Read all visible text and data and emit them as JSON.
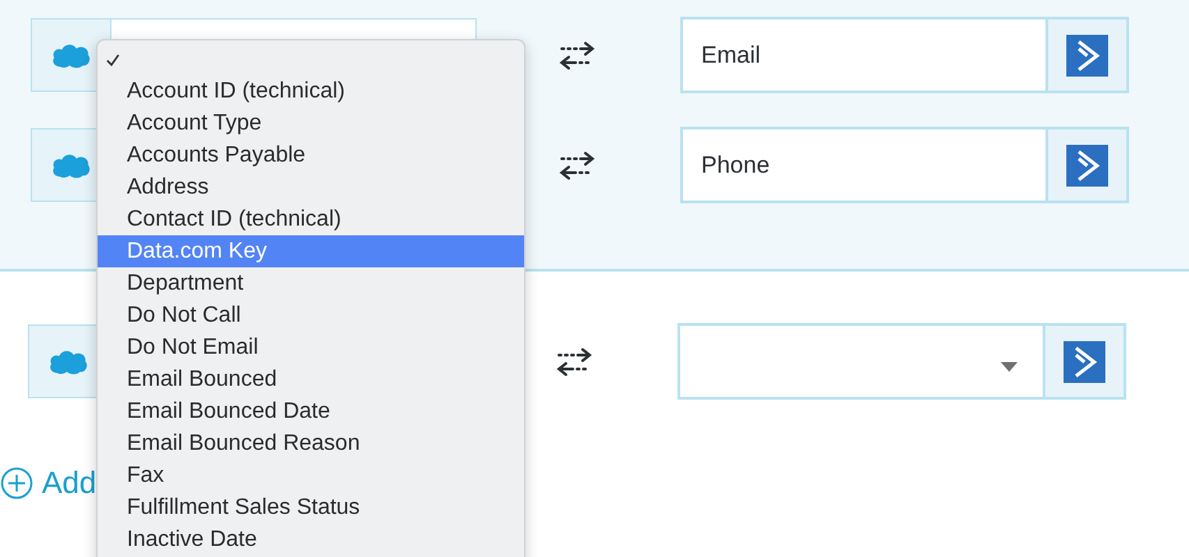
{
  "mapping_groups": [
    {
      "kind": "panel",
      "rows": [
        {
          "target": {
            "kind": "text",
            "value": "Email"
          }
        },
        {
          "target": {
            "kind": "text",
            "value": "Phone"
          }
        }
      ]
    },
    {
      "kind": "plain",
      "rows": [
        {
          "target": {
            "kind": "select"
          }
        }
      ]
    }
  ],
  "add_button": {
    "label": "Add"
  },
  "dropdown": {
    "items": [
      {
        "checked": true,
        "selected": false
      },
      {
        "label": "Account ID (technical)",
        "checked": false,
        "selected": false
      },
      {
        "label": "Account Type",
        "checked": false,
        "selected": false
      },
      {
        "label": "Accounts Payable",
        "checked": false,
        "selected": false
      },
      {
        "label": "Address",
        "checked": false,
        "selected": false
      },
      {
        "label": "Contact ID (technical)",
        "checked": false,
        "selected": false
      },
      {
        "label": "Data.com Key",
        "checked": false,
        "selected": true
      },
      {
        "label": "Department",
        "checked": false,
        "selected": false
      },
      {
        "label": "Do Not Call",
        "checked": false,
        "selected": false
      },
      {
        "label": "Do Not Email",
        "checked": false,
        "selected": false
      },
      {
        "label": "Email Bounced",
        "checked": false,
        "selected": false
      },
      {
        "label": "Email Bounced Date",
        "checked": false,
        "selected": false
      },
      {
        "label": "Email Bounced Reason",
        "checked": false,
        "selected": false
      },
      {
        "label": "Fax",
        "checked": false,
        "selected": false
      },
      {
        "label": "Fulfillment Sales Status",
        "checked": false,
        "selected": false
      },
      {
        "label": "Inactive Date",
        "checked": false,
        "selected": false
      }
    ]
  }
}
